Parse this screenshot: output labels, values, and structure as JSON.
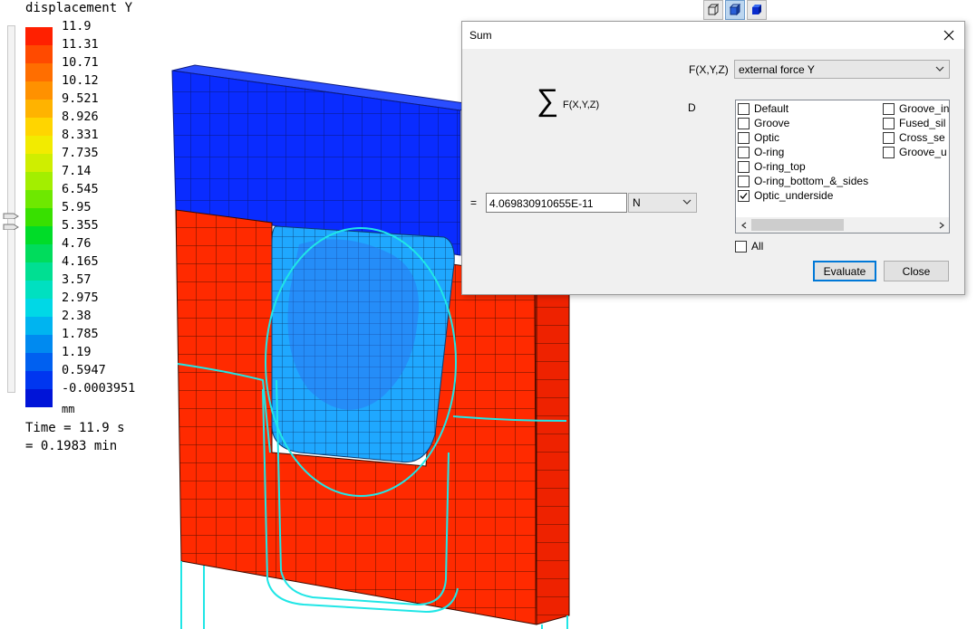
{
  "legend": {
    "title": "displacement Y",
    "values": [
      "11.9",
      "11.31",
      "10.71",
      "10.12",
      "9.521",
      "8.926",
      "8.331",
      "7.735",
      "7.14",
      "6.545",
      "5.95",
      "5.355",
      "4.76",
      "4.165",
      "3.57",
      "2.975",
      "2.38",
      "1.785",
      "1.19",
      "0.5947",
      "-0.0003951"
    ],
    "colors": [
      "#ff2000",
      "#ff4a00",
      "#ff6e00",
      "#ff9100",
      "#ffb300",
      "#ffd500",
      "#f2eb00",
      "#cfee00",
      "#a3ee00",
      "#6ee800",
      "#38e000",
      "#00dc28",
      "#00dc5c",
      "#00df92",
      "#00e0c0",
      "#00d8e6",
      "#00b4f0",
      "#008af0",
      "#0060f0",
      "#0036f0",
      "#0014d8"
    ],
    "units": "mm",
    "time_line": "Time = 11.9 s",
    "time_min_line": "= 0.1983 min"
  },
  "view_toolbar": {
    "icons": [
      "cube-outline-icon",
      "cube-shaded-icon",
      "cube-solid-icon"
    ]
  },
  "dialog": {
    "title": "Sum",
    "function_label": "F(X,Y,Z)",
    "sum_symbol": "∑",
    "sum_expression": "F(X,Y,Z)",
    "domain_label": "D",
    "quantity": "external force Y",
    "equals_sign": "=",
    "result_value": "4.069830910655E-11",
    "result_unit": "N",
    "domains": [
      {
        "label": "Default",
        "checked": false
      },
      {
        "label": "Groove",
        "checked": false
      },
      {
        "label": "Optic",
        "checked": false
      },
      {
        "label": "O-ring",
        "checked": false
      },
      {
        "label": "O-ring_top",
        "checked": false
      },
      {
        "label": "O-ring_bottom_&_sides",
        "checked": false
      },
      {
        "label": "Optic_underside",
        "checked": true
      },
      {
        "label": "Groove_in",
        "checked": false
      },
      {
        "label": "Fused_sil",
        "checked": false
      },
      {
        "label": "Cross_se",
        "checked": false
      },
      {
        "label": "Groove_u",
        "checked": false
      }
    ],
    "all_label": "All",
    "all_checked": false,
    "evaluate_label": "Evaluate",
    "close_label": "Close"
  }
}
